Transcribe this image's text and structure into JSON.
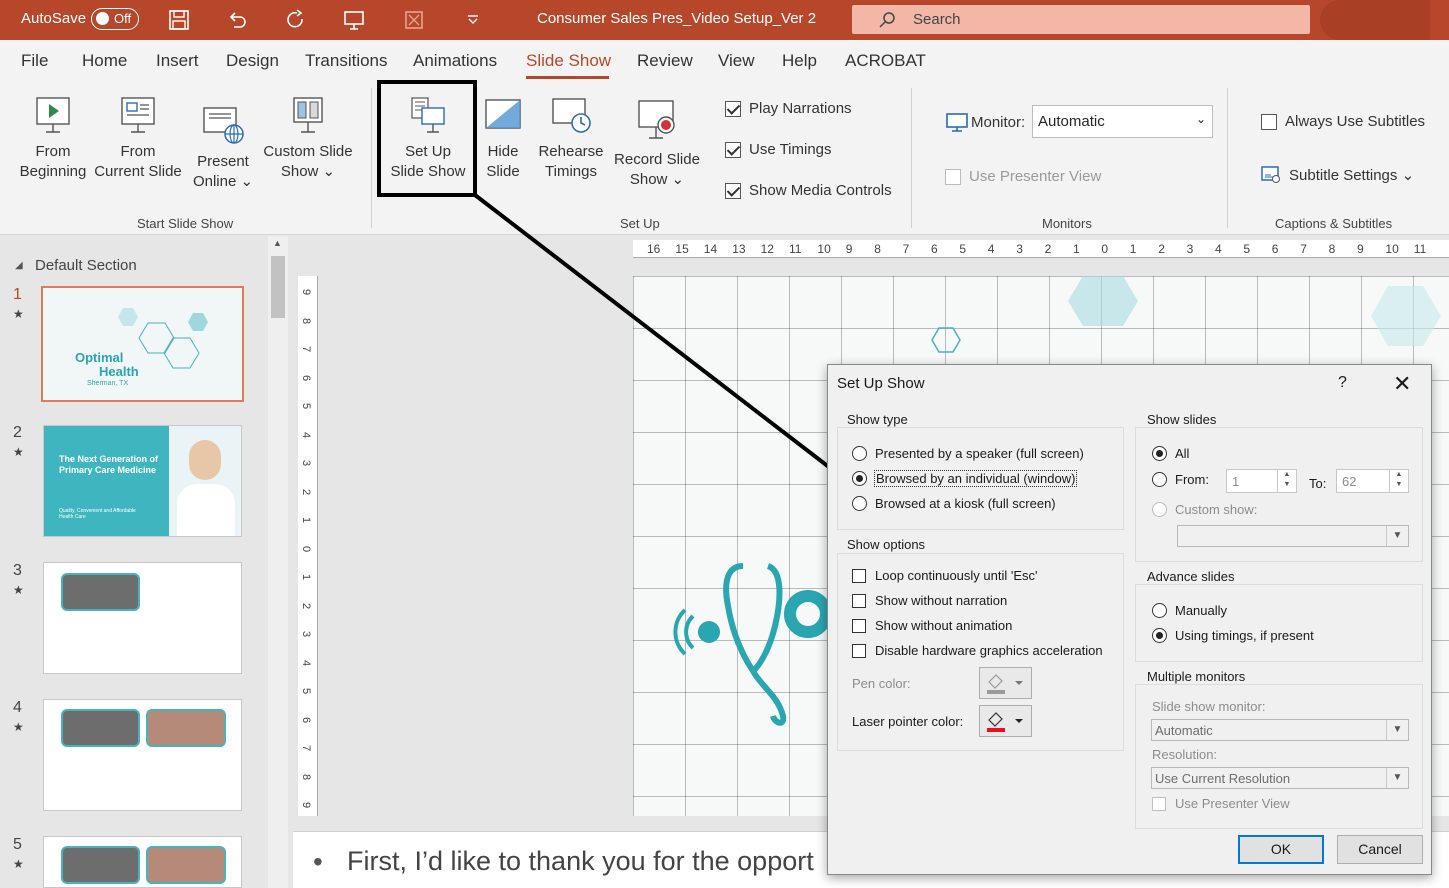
{
  "titlebar": {
    "autosave_label": "AutoSave",
    "autosave_state": "Off",
    "doc_title": "Consumer Sales Pres_Video Setup_Ver 2",
    "search_placeholder": "Search"
  },
  "menu": [
    "File",
    "Home",
    "Insert",
    "Design",
    "Transitions",
    "Animations",
    "Slide Show",
    "Review",
    "View",
    "Help",
    "ACROBAT"
  ],
  "menu_active": "Slide Show",
  "ribbon": {
    "start": {
      "from_beginning": [
        "From",
        "Beginning"
      ],
      "from_current": [
        "From",
        "Current Slide"
      ],
      "present_online": [
        "Present",
        "Online ⌄"
      ],
      "custom_slide_show": [
        "Custom Slide",
        "Show ⌄"
      ],
      "group_label": "Start Slide Show"
    },
    "setup": {
      "set_up_slide_show": [
        "Set Up",
        "Slide Show"
      ],
      "hide_slide": [
        "Hide",
        "Slide"
      ],
      "rehearse_timings": [
        "Rehearse",
        "Timings"
      ],
      "record_slide_show": [
        "Record Slide",
        "Show ⌄"
      ],
      "play_narrations": "Play Narrations",
      "use_timings": "Use Timings",
      "show_media_controls": "Show Media Controls",
      "group_label": "Set Up"
    },
    "monitors": {
      "monitor_label": "Monitor:",
      "monitor_value": "Automatic",
      "use_presenter_view": "Use Presenter View",
      "group_label": "Monitors"
    },
    "captions": {
      "always_use_subtitles": "Always Use Subtitles",
      "subtitle_settings": "Subtitle Settings ⌄",
      "group_label": "Captions & Subtitles"
    }
  },
  "slides_pane": {
    "section": "Default Section",
    "slides": [
      {
        "num": "1",
        "title_a": "Optimal",
        "title_b": "Health",
        "sub": "Sherman, TX"
      },
      {
        "num": "2",
        "title": "The Next Generation of Primary Care Medicine",
        "sub": "Quality, Convenient and Affordable Health Care"
      },
      {
        "num": "3"
      },
      {
        "num": "4"
      },
      {
        "num": "5"
      }
    ]
  },
  "ruler_h": [
    "16",
    "15",
    "14",
    "13",
    "12",
    "11",
    "10",
    "9",
    "8",
    "7",
    "6",
    "5",
    "4",
    "3",
    "2",
    "1",
    "0",
    "1",
    "2",
    "3",
    "4",
    "5",
    "6",
    "7",
    "8",
    "9",
    "10",
    "11"
  ],
  "ruler_v": [
    "9",
    "8",
    "7",
    "6",
    "5",
    "4",
    "3",
    "2",
    "1",
    "0",
    "1",
    "2",
    "3",
    "4",
    "5",
    "6",
    "7",
    "8",
    "9"
  ],
  "notes_text": "First, I’d like to thank you for the opport",
  "dialog": {
    "title": "Set Up Show",
    "help": "?",
    "close": "✕",
    "show_type": {
      "legend": "Show type",
      "options": [
        "Presented by a speaker (full screen)",
        "Browsed by an individual (window)",
        "Browsed at a kiosk (full screen)"
      ],
      "selected": 1
    },
    "show_options": {
      "legend": "Show options",
      "loop": "Loop continuously until 'Esc'",
      "no_narration": "Show without narration",
      "no_animation": "Show without animation",
      "disable_hw": "Disable hardware graphics acceleration",
      "pen_color": "Pen color:",
      "laser_color": "Laser pointer color:",
      "laser_swatch": "#e81123"
    },
    "show_slides": {
      "legend": "Show slides",
      "all": "All",
      "from": "From:",
      "from_value": "1",
      "to": "To:",
      "to_value": "62",
      "custom_show": "Custom show:"
    },
    "advance": {
      "legend": "Advance slides",
      "manually": "Manually",
      "using_timings": "Using timings, if present"
    },
    "multiple_monitors": {
      "legend": "Multiple monitors",
      "slide_show_monitor": "Slide show monitor:",
      "monitor_value": "Automatic",
      "resolution": "Resolution:",
      "resolution_value": "Use Current Resolution",
      "use_presenter_view": "Use Presenter View"
    },
    "ok": "OK",
    "cancel": "Cancel"
  },
  "colors": {
    "accent": "#b7472a",
    "teal": "#2aa6b1"
  }
}
